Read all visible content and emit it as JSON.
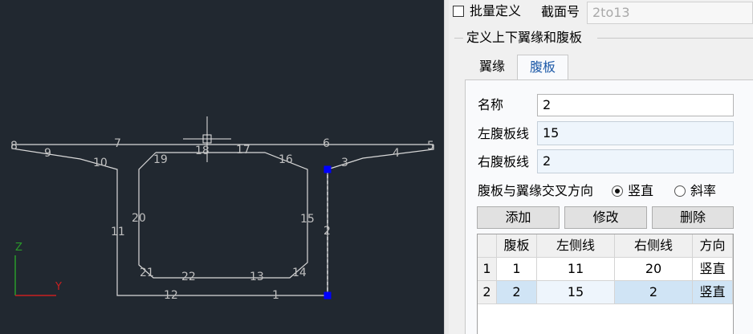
{
  "canvas": {
    "background": "#212830",
    "line_color": "#d9d9d9",
    "label_color": "#bfbfbf",
    "marker_color": "#0000ff",
    "segment_labels": [
      "8",
      "9",
      "10",
      "7",
      "19",
      "18",
      "17",
      "16",
      "6",
      "3",
      "4",
      "5",
      "11",
      "20",
      "15",
      "2",
      "21",
      "22",
      "13",
      "14",
      "12",
      "1"
    ],
    "axis": {
      "z_label": "Z",
      "y_label": "Y",
      "z_color": "#2a9a2a",
      "y_color": "#c92020"
    }
  },
  "panel": {
    "batch_define_label": "批量定义",
    "section_no_label": "截面号",
    "section_no_value": "2to13",
    "group_title": "定义上下翼缘和腹板",
    "tabs": [
      {
        "label": "翼缘",
        "active": false
      },
      {
        "label": "腹板",
        "active": true
      }
    ],
    "form": {
      "name_label": "名称",
      "name_value": "2",
      "left_web_label": "左腹板线",
      "left_web_value": "15",
      "right_web_label": "右腹板线",
      "right_web_value": "2",
      "direction_label": "腹板与翼缘交叉方向",
      "direction_options": [
        "竖直",
        "斜率"
      ],
      "direction_selected": "竖直"
    },
    "buttons": {
      "add": "添加",
      "modify": "修改",
      "delete": "删除"
    },
    "table": {
      "columns": [
        "腹板",
        "左侧线",
        "右侧线",
        "方向"
      ],
      "rows": [
        {
          "row_no": "1",
          "cells": [
            "1",
            "11",
            "20",
            "竖直"
          ]
        },
        {
          "row_no": "2",
          "cells": [
            "2",
            "15",
            "2",
            "竖直"
          ]
        }
      ]
    }
  }
}
